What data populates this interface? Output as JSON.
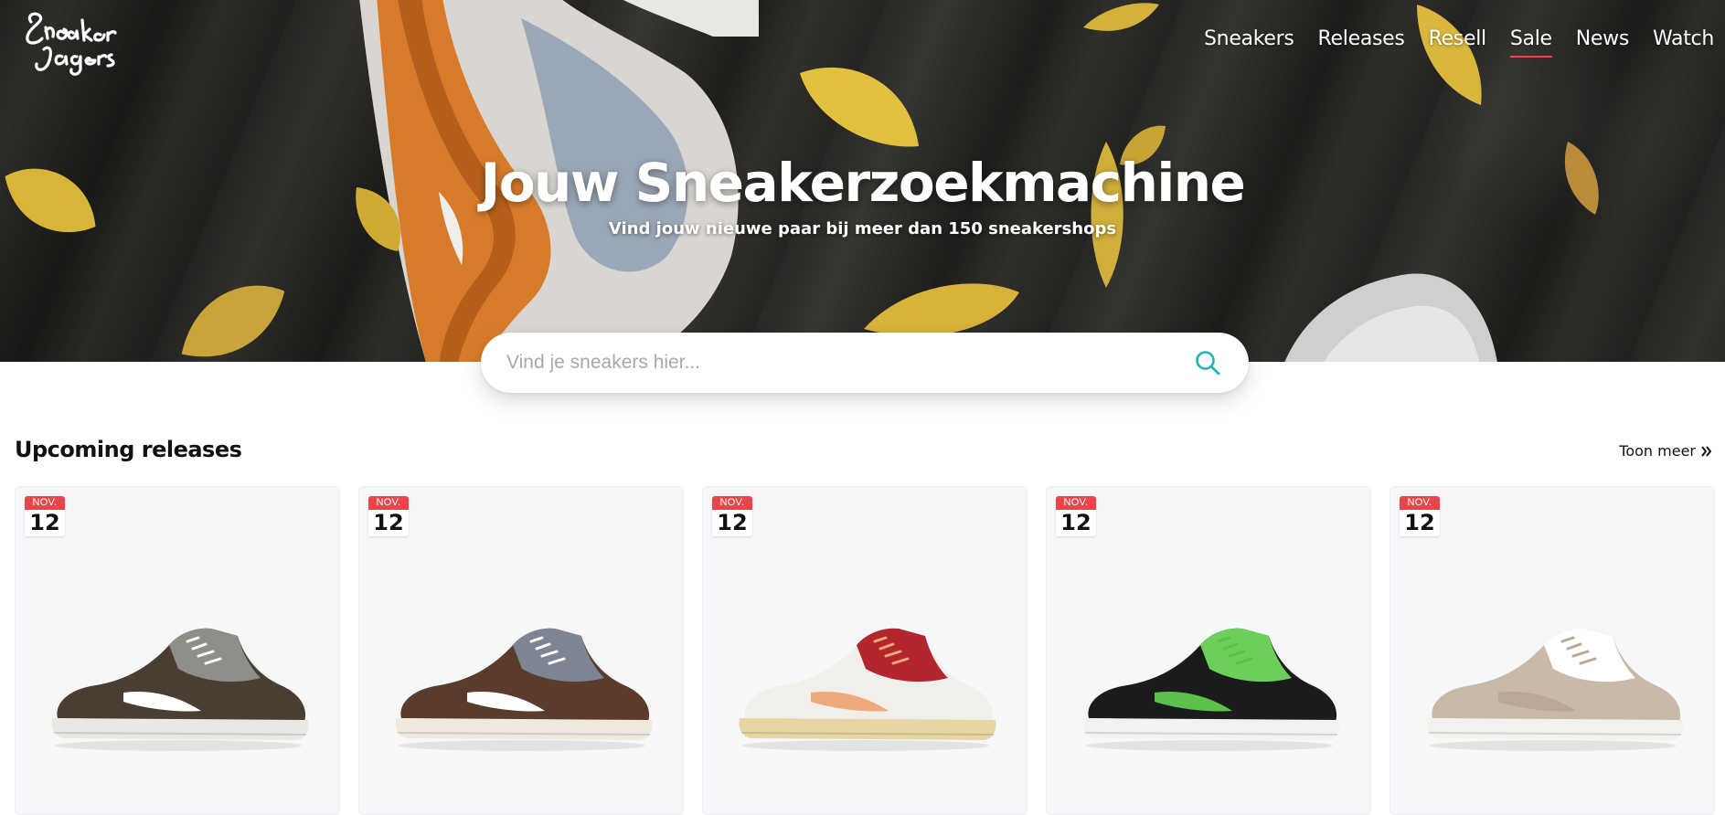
{
  "brand": {
    "logo_text": "Sneaker Jagers"
  },
  "nav": {
    "items": [
      {
        "label": "Sneakers",
        "active": false
      },
      {
        "label": "Releases",
        "active": false
      },
      {
        "label": "Resell",
        "active": false
      },
      {
        "label": "Sale",
        "active": true
      },
      {
        "label": "News",
        "active": false
      },
      {
        "label": "Watch",
        "active": false
      }
    ]
  },
  "hero": {
    "title": "Jouw Sneakerzoekmachine",
    "subtitle": "Vind jouw nieuwe paar bij meer dan 150 sneakershops"
  },
  "search": {
    "placeholder": "Vind je sneakers hier...",
    "value": "",
    "icon": "search-icon"
  },
  "upcoming": {
    "title": "Upcoming releases",
    "more_label": "Toon meer",
    "more_icon": "double-chevron-right-icon",
    "cards": [
      {
        "month": "NOV.",
        "day": "12",
        "colors": {
          "upper": "#4a3d31",
          "overlay": "#8d8d8a",
          "sole": "#e8e8e4",
          "accent": "#ffffff"
        }
      },
      {
        "month": "NOV.",
        "day": "12",
        "colors": {
          "upper": "#5a3b2c",
          "overlay": "#7d8592",
          "sole": "#efeadd",
          "accent": "#ffffff"
        }
      },
      {
        "month": "NOV.",
        "day": "12",
        "colors": {
          "upper": "#f1efe9",
          "overlay": "#b3262d",
          "sole": "#e6d6a4",
          "accent": "#f0a97a"
        }
      },
      {
        "month": "NOV.",
        "day": "12",
        "colors": {
          "upper": "#1b1b1b",
          "overlay": "#6ccf5a",
          "sole": "#f2f2f2",
          "accent": "#5cc14a"
        }
      },
      {
        "month": "NOV.",
        "day": "12",
        "colors": {
          "upper": "#c8b9a8",
          "overlay": "#ffffff",
          "sole": "#f3f1ee",
          "accent": "#b9a896"
        }
      }
    ]
  }
}
